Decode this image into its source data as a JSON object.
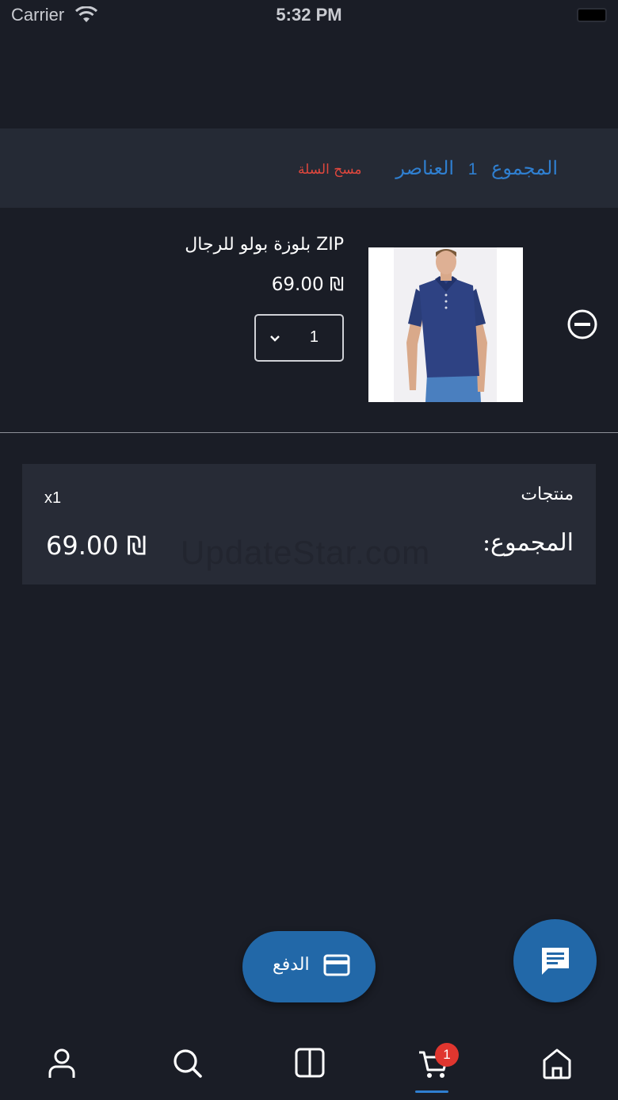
{
  "status_bar": {
    "carrier": "Carrier",
    "time": "5:32 PM"
  },
  "cart_header": {
    "total_label": "المجموع",
    "item_count": "1",
    "items_label": "العناصر",
    "clear_cart": "مسح السلة"
  },
  "cart_item": {
    "name": "ZIP بلوزة بولو للرجال",
    "price": "₪ 69.00",
    "quantity": "1"
  },
  "totals": {
    "products_label": "منتجات",
    "products_count": "x1",
    "total_label": "المجموع:",
    "total_value": "₪ 69.00",
    "watermark": "UpdateStar.com"
  },
  "checkout": {
    "label": "الدفع"
  },
  "bottom_nav": {
    "cart_badge": "1",
    "active": "cart"
  },
  "colors": {
    "background": "#1a1d26",
    "accent": "#2268a8",
    "link": "#2f7fd0",
    "danger": "#e0473d"
  }
}
